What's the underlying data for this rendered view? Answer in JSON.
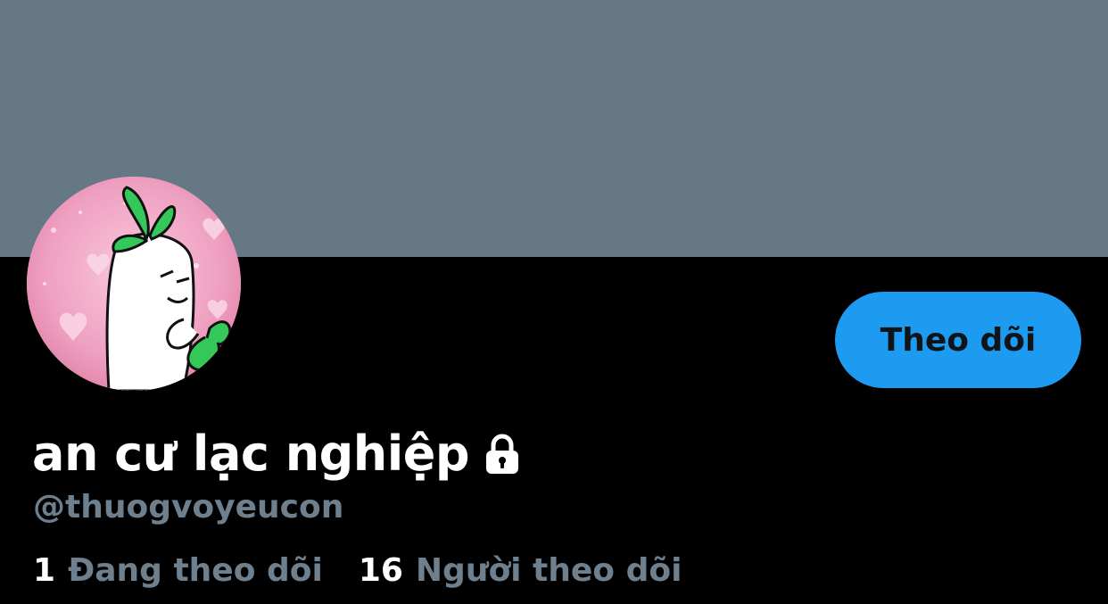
{
  "profile": {
    "display_name": "an cư lạc nghiệp",
    "handle": "@thuogvoyeucon",
    "protected": true,
    "follow_button_label": "Theo dõi",
    "stats": [
      {
        "count": "1",
        "label": "Đang theo dõi"
      },
      {
        "count": "16",
        "label": "Người theo dõi"
      }
    ]
  },
  "colors": {
    "banner": "#667786",
    "background": "#000000",
    "accent": "#1d9bf0",
    "secondary_text": "#6e7f8d"
  },
  "icons": {
    "lock": "lock-icon",
    "avatar": "avatar-radish-cartoon"
  }
}
